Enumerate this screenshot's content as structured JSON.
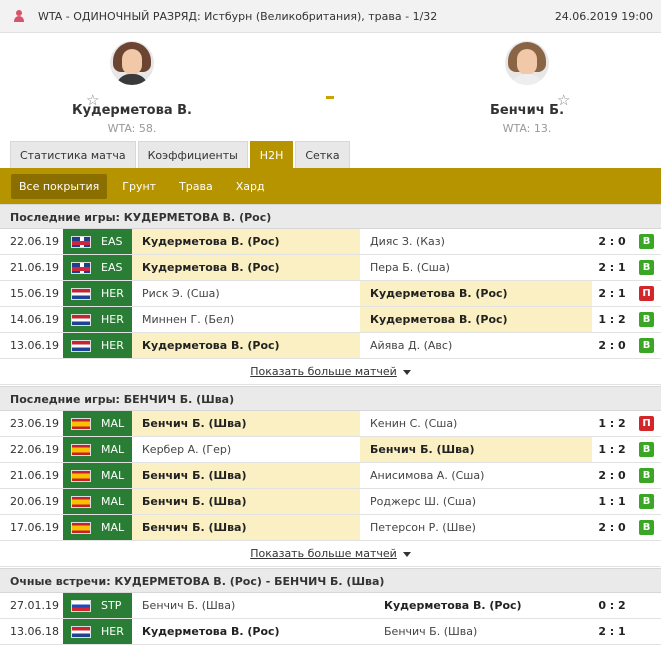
{
  "header": {
    "tournament": "WTA - ОДИНОЧНЫЙ РАЗРЯД: Истбурн (Великобритания), трава - 1/32",
    "datetime": "24.06.2019 19:00",
    "icon": "player-pin-icon"
  },
  "match": {
    "home": {
      "name": "Кудерметова В.",
      "rank": "WTA: 58."
    },
    "away": {
      "name": "Бенчич Б.",
      "rank": "WTA: 13."
    },
    "score": "-"
  },
  "tabs": [
    "Статистика матча",
    "Коэффициенты",
    "H2H",
    "Сетка"
  ],
  "filters": [
    "Все покрытия",
    "Грунт",
    "Трава",
    "Хард"
  ],
  "sections": {
    "home": {
      "title": "Последние игры: КУДЕРМЕТОВА В. (Рос)",
      "rows": [
        {
          "date": "22.06.19",
          "flag": "gb",
          "code": "EAS",
          "p1": "Кудерметова В. (Рос)",
          "p2": "Дияс З. (Каз)",
          "score": "2 : 0",
          "result": "В",
          "win": true,
          "hl": 1
        },
        {
          "date": "21.06.19",
          "flag": "gb",
          "code": "EAS",
          "p1": "Кудерметова В. (Рос)",
          "p2": "Пера Б. (Сша)",
          "score": "2 : 1",
          "result": "В",
          "win": true,
          "hl": 1
        },
        {
          "date": "15.06.19",
          "flag": "nl",
          "code": "HER",
          "p1": "Риск Э. (Сша)",
          "p2": "Кудерметова В. (Рос)",
          "score": "2 : 1",
          "result": "П",
          "win": false,
          "hl": 2
        },
        {
          "date": "14.06.19",
          "flag": "nl",
          "code": "HER",
          "p1": "Миннен Г. (Бел)",
          "p2": "Кудерметова В. (Рос)",
          "score": "1 : 2",
          "result": "В",
          "win": true,
          "hl": 2
        },
        {
          "date": "13.06.19",
          "flag": "nl",
          "code": "HER",
          "p1": "Кудерметова В. (Рос)",
          "p2": "Айява Д. (Авс)",
          "score": "2 : 0",
          "result": "В",
          "win": true,
          "hl": 1
        }
      ],
      "more": "Показать больше матчей"
    },
    "away": {
      "title": "Последние игры: БЕНЧИЧ Б. (Шва)",
      "rows": [
        {
          "date": "23.06.19",
          "flag": "es",
          "code": "MAL",
          "p1": "Бенчич Б. (Шва)",
          "p2": "Кенин С. (Сша)",
          "score": "1 : 2",
          "result": "П",
          "win": false,
          "hl": 1
        },
        {
          "date": "22.06.19",
          "flag": "es",
          "code": "MAL",
          "p1": "Кербер А. (Гер)",
          "p2": "Бенчич Б. (Шва)",
          "score": "1 : 2",
          "result": "В",
          "win": true,
          "hl": 2
        },
        {
          "date": "21.06.19",
          "flag": "es",
          "code": "MAL",
          "p1": "Бенчич Б. (Шва)",
          "p2": "Анисимова А. (Сша)",
          "score": "2 : 0",
          "result": "В",
          "win": true,
          "hl": 1
        },
        {
          "date": "20.06.19",
          "flag": "es",
          "code": "MAL",
          "p1": "Бенчич Б. (Шва)",
          "p2": "Роджерс Ш. (Сша)",
          "score": "1 : 1",
          "result": "В",
          "win": true,
          "hl": 1
        },
        {
          "date": "17.06.19",
          "flag": "es",
          "code": "MAL",
          "p1": "Бенчич Б. (Шва)",
          "p2": "Петерсон Р. (Шве)",
          "score": "2 : 0",
          "result": "В",
          "win": true,
          "hl": 1
        }
      ],
      "more": "Показать больше матчей"
    },
    "h2h": {
      "title": "Очные встречи: КУДЕРМЕТОВА В. (Рос) - БЕНЧИЧ Б. (Шва)",
      "rows": [
        {
          "date": "27.01.19",
          "flag": "ru",
          "code": "STP",
          "p1": "Бенчич Б. (Шва)",
          "p2": "Кудерметова В. (Рос)",
          "score": "0 : 2",
          "bold": 2
        },
        {
          "date": "13.06.18",
          "flag": "nl",
          "code": "HER",
          "p1": "Кудерметова В. (Рос)",
          "p2": "Бенчич Б. (Шва)",
          "score": "2 : 1",
          "bold": 1
        }
      ]
    }
  }
}
